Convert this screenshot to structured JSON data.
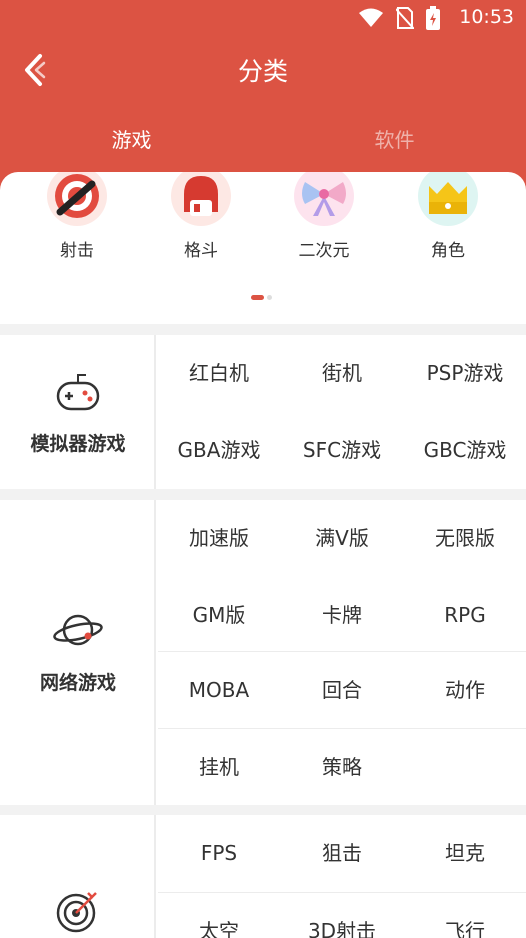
{
  "status_bar": {
    "time": "10:53"
  },
  "header": {
    "title": "分类",
    "tabs": [
      {
        "label": "游戏"
      },
      {
        "label": "软件"
      }
    ],
    "bg_color": "#dc5343"
  },
  "quick_categories": [
    {
      "label": "射击",
      "icon": "target-icon"
    },
    {
      "label": "格斗",
      "icon": "boxing-glove-icon"
    },
    {
      "label": "二次元",
      "icon": "bow-icon"
    },
    {
      "label": "角色",
      "icon": "crown-icon"
    }
  ],
  "sections": [
    {
      "name": "模拟器游戏",
      "icon": "gamepad-icon",
      "items": [
        "红白机",
        "街机",
        "PSP游戏",
        "GBA游戏",
        "SFC游戏",
        "GBC游戏"
      ]
    },
    {
      "name": "网络游戏",
      "icon": "planet-icon",
      "items": [
        "加速版",
        "满V版",
        "无限版",
        "GM版",
        "卡牌",
        "RPG",
        "MOBA",
        "回合",
        "动作",
        "挂机",
        "策略"
      ]
    },
    {
      "name": "",
      "icon": "target-icon",
      "items": [
        "FPS",
        "狙击",
        "坦克",
        "太空",
        "3D射击",
        "飞行"
      ]
    }
  ]
}
